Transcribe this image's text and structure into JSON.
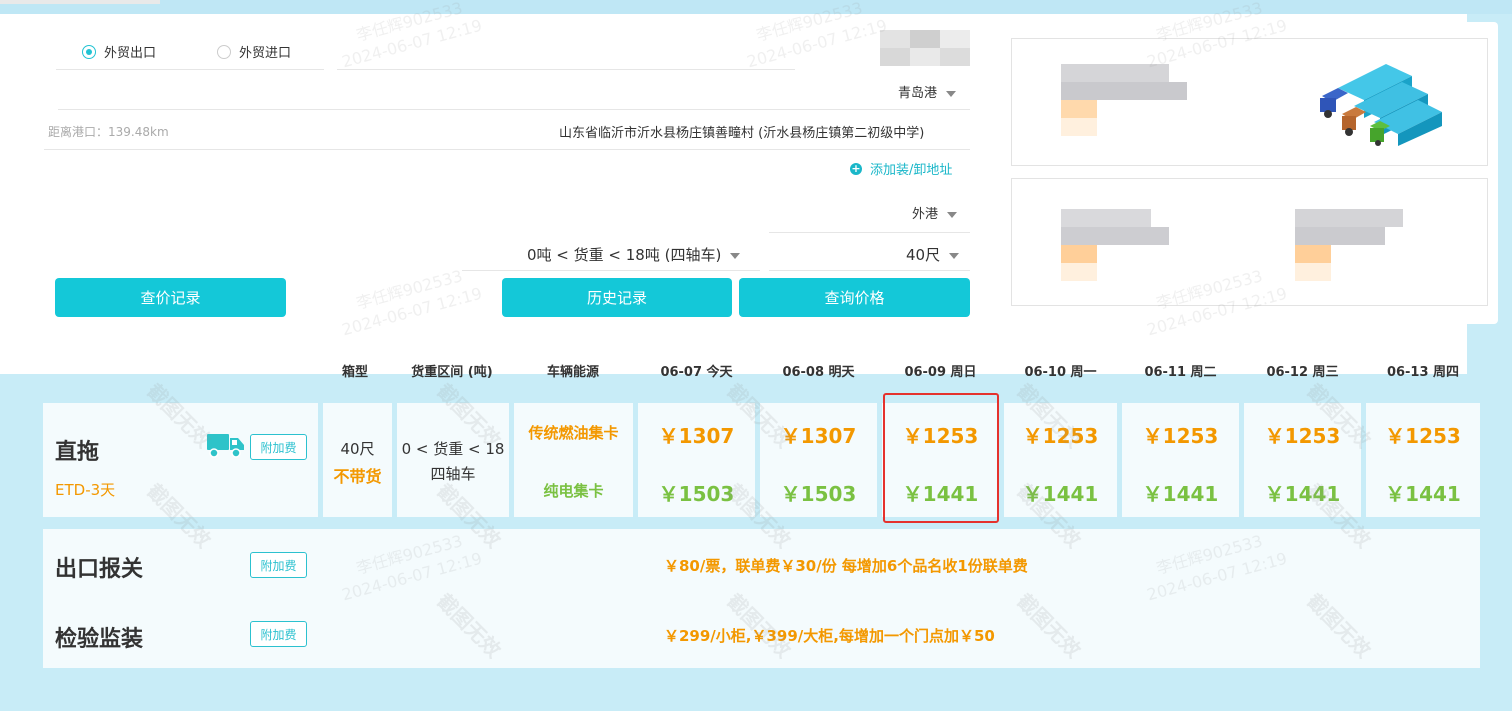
{
  "form": {
    "trade_types": [
      "外贸出口",
      "外贸进口"
    ],
    "port": "青岛港",
    "distance": "距离港口：139.48km",
    "address": "山东省临沂市沂水县杨庄镇善疃村 (沂水县杨庄镇第二初级中学)",
    "add_address": "添加装/卸地址",
    "port_type": "外港",
    "weight_range": "0吨 < 货重 < 18吨 (四轴车)",
    "container_size": "40尺",
    "buttons": {
      "price_history": "查价记录",
      "history": "历史记录",
      "query": "查询价格"
    }
  },
  "table": {
    "headers": [
      "箱型",
      "货重区间 (吨)",
      "车辆能源"
    ],
    "dates": [
      "06-07 今天",
      "06-08 明天",
      "06-09 周日",
      "06-10 周一",
      "06-11 周二",
      "06-12 周三",
      "06-13 周四"
    ],
    "service": "直拖",
    "etd": "ETD-3天",
    "extra_fee": "附加费",
    "box_size": "40尺",
    "no_cargo": "不带货",
    "weight_line1": "0 < 货重 < 18",
    "weight_line2": "四轴车",
    "energy_fuel": "传统燃油集卡",
    "energy_electric": "纯电集卡",
    "fuel_prices": [
      "￥1307",
      "￥1307",
      "￥1253",
      "￥1253",
      "￥1253",
      "￥1253",
      "￥1253"
    ],
    "electric_prices": [
      "￥1503",
      "￥1503",
      "￥1441",
      "￥1441",
      "￥1441",
      "￥1441",
      "￥1441"
    ],
    "customs_label": "出口报关",
    "customs_fee": "￥80/票，联单费￥30/份   每增加6个品名收1份联单费",
    "inspection_label": "检验监装",
    "inspection_fee": "￥299/小柜,￥399/大柜,每增加一个门点加￥50"
  },
  "watermarks": {
    "tag": "截图无效",
    "user": "李任辉902533",
    "time": "2024-06-07 12:19"
  },
  "colors": {
    "accent": "#14c8d8",
    "price_orange": "#f39800",
    "price_green": "#7ac142",
    "highlight": "#e5322d"
  }
}
